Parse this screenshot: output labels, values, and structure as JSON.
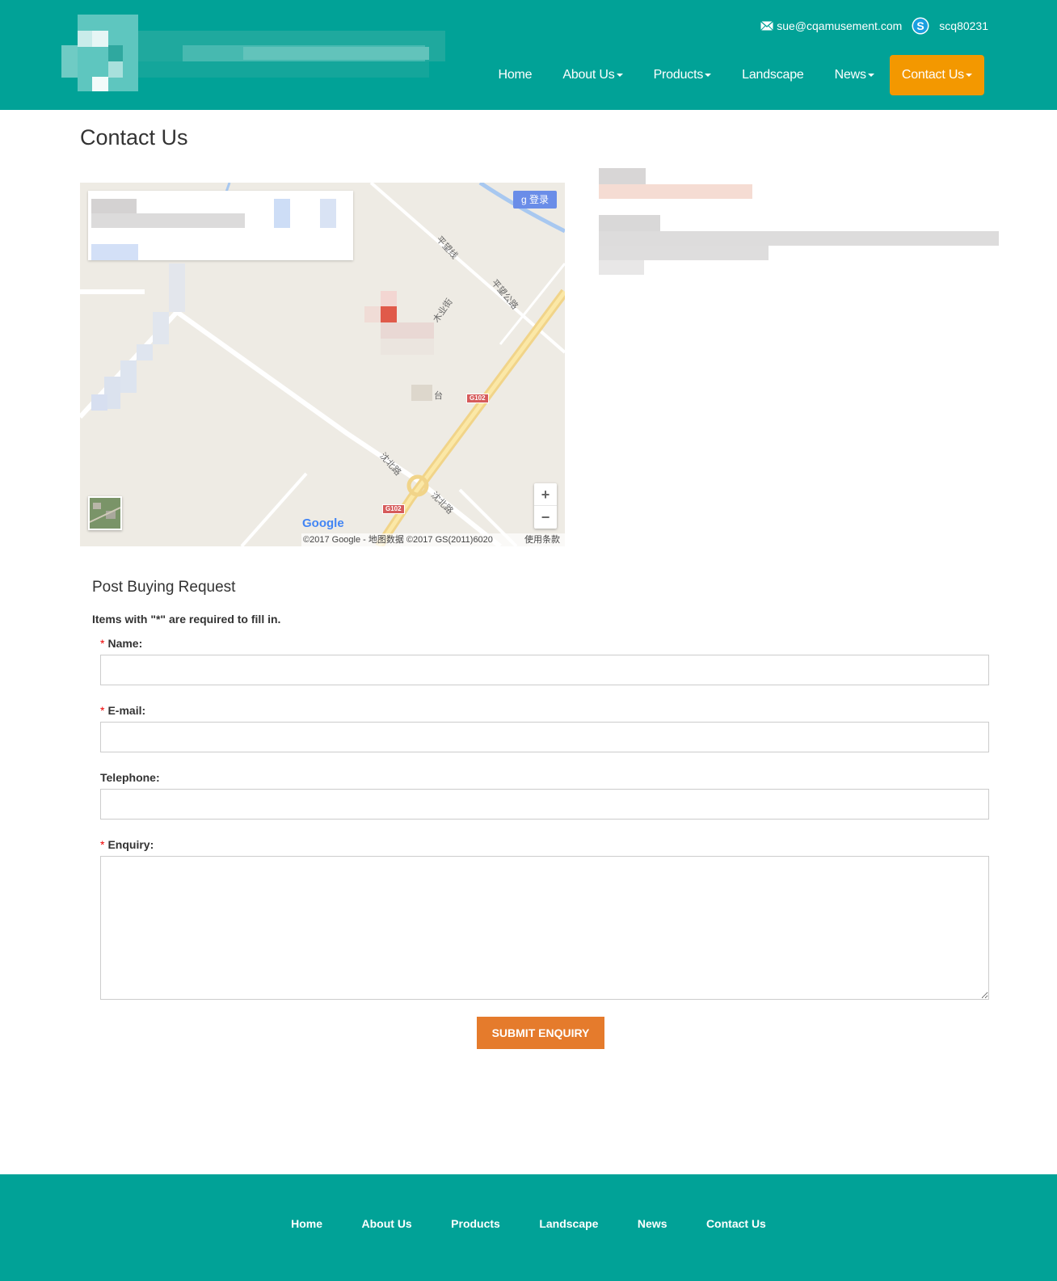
{
  "header": {
    "email": "sue@cqamusement.com",
    "skype": "scq80231",
    "nav": [
      {
        "label": "Home",
        "dropdown": false
      },
      {
        "label": "About Us",
        "dropdown": true
      },
      {
        "label": "Products",
        "dropdown": true
      },
      {
        "label": "Landscape",
        "dropdown": false
      },
      {
        "label": "News",
        "dropdown": true
      },
      {
        "label": "Contact Us",
        "dropdown": true,
        "active": true
      }
    ],
    "colors": {
      "background": "#01a297",
      "active": "#f39800"
    }
  },
  "page": {
    "title": "Contact Us"
  },
  "map": {
    "login_label": "登录",
    "login_icon": "google-plus-icon",
    "zoom_in": "+",
    "zoom_out": "−",
    "google_logo": "Google",
    "credit": "©2017 Google - 地图数据 ©2017 GS(2011)6020",
    "terms": "使用条款",
    "labels": {
      "road1": "平望线",
      "road2": "平望公路",
      "road3": "木业街",
      "road4": "沈北路",
      "road5": "沈北路",
      "place": "台",
      "shield1": "G102",
      "shield2": "G102"
    }
  },
  "form": {
    "title": "Post Buying Request",
    "note": "Items with \"*\" are required to fill in.",
    "required_mark": "*",
    "fields": {
      "name": "Name:",
      "email": "E-mail:",
      "telephone": "Telephone:",
      "enquiry": "Enquiry:"
    },
    "submit": "SUBMIT ENQUIRY",
    "submit_color": "#e57b2c"
  },
  "footer": {
    "nav": [
      "Home",
      "About Us",
      "Products",
      "Landscape",
      "News",
      "Contact Us"
    ]
  }
}
